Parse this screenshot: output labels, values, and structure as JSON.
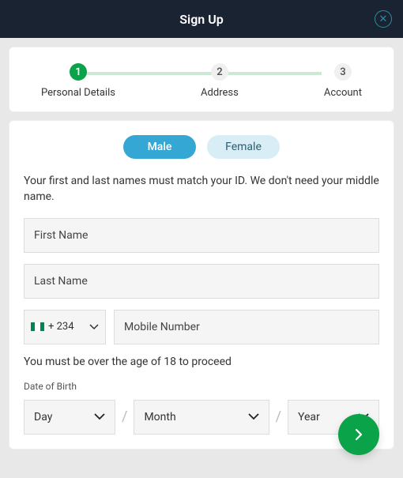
{
  "header": {
    "title": "Sign Up"
  },
  "stepper": {
    "steps": [
      {
        "num": "1",
        "label": "Personal Details",
        "active": true
      },
      {
        "num": "2",
        "label": "Address",
        "active": false
      },
      {
        "num": "3",
        "label": "Account",
        "active": false
      }
    ]
  },
  "gender": {
    "male": "Male",
    "female": "Female"
  },
  "form": {
    "name_instruction": "Your first and last names must match your ID. We don't need your middle name.",
    "first_name_placeholder": "First Name",
    "last_name_placeholder": "Last Name",
    "country_code": "+ 234",
    "mobile_placeholder": "Mobile Number",
    "age_note": "You must be over the age of 18 to proceed",
    "dob_label": "Date of Birth",
    "day_label": "Day",
    "month_label": "Month",
    "year_label": "Year"
  },
  "colors": {
    "flag_green": "#008751",
    "flag_white": "#ffffff"
  }
}
